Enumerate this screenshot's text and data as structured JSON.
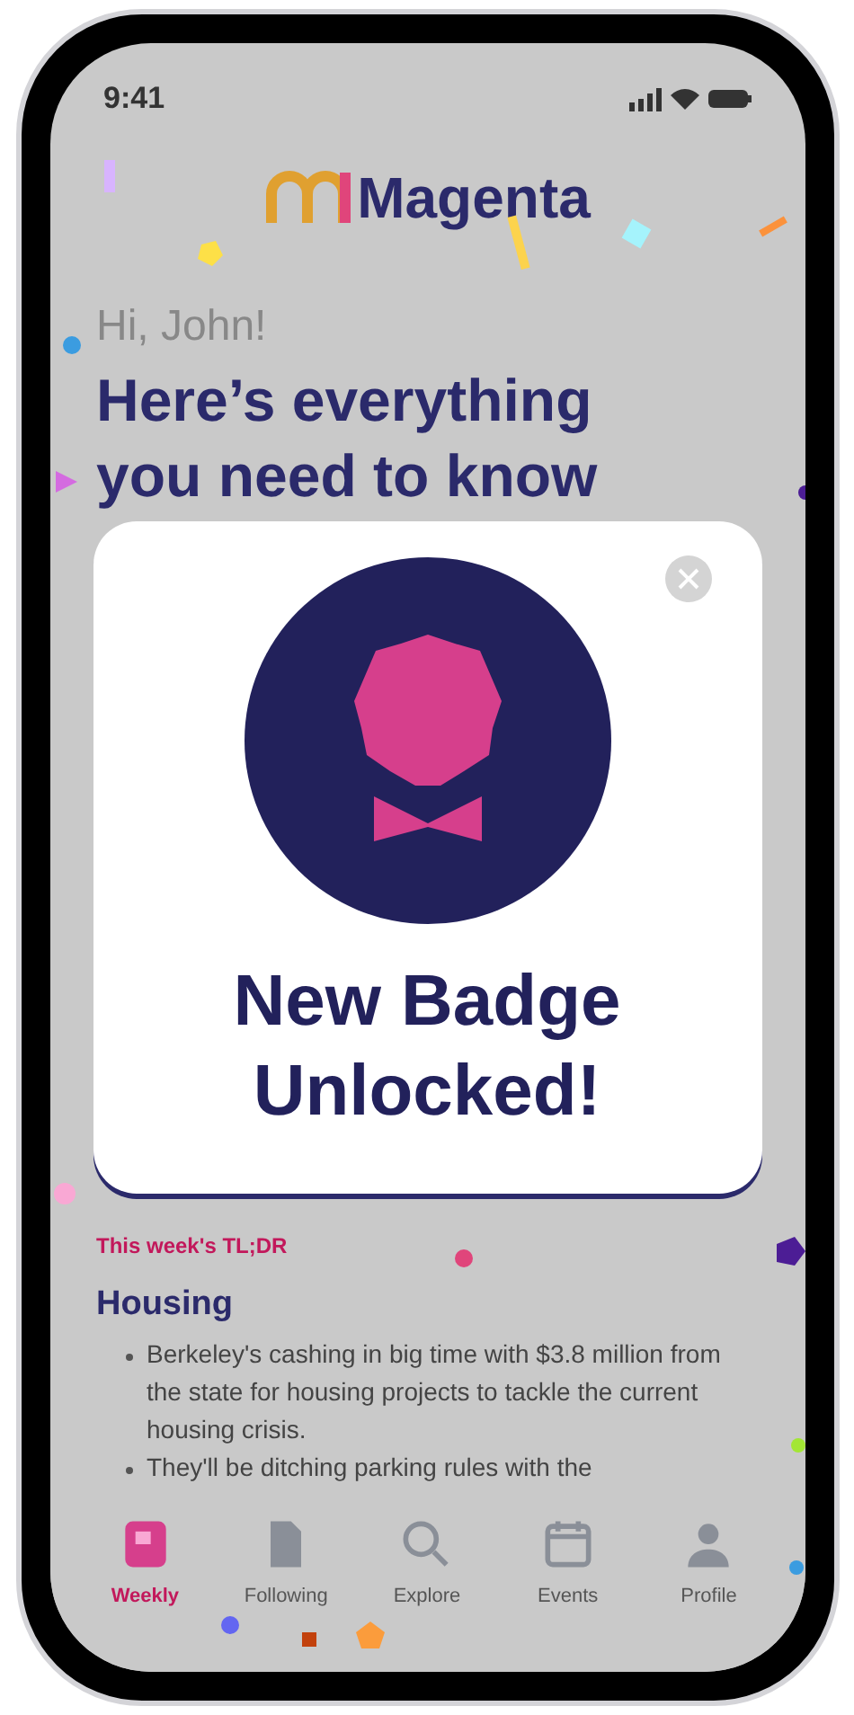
{
  "status_bar": {
    "time": "9:41"
  },
  "header": {
    "logo_text": "Magenta"
  },
  "greeting": "Hi, John!",
  "headline": "Here’s everything you need to know",
  "tldr": {
    "label": "This week's TL;DR",
    "title": "Housing",
    "bullets": [
      "Berkeley's cashing in big time with $3.8 million from the state for housing projects to tackle the current housing crisis.",
      "They'll be ditching parking rules with the"
    ]
  },
  "modal": {
    "title": "New Badge Unlocked!"
  },
  "tab_bar": [
    {
      "label": "Weekly",
      "selected": true
    },
    {
      "label": "Following",
      "selected": false
    },
    {
      "label": "Explore",
      "selected": false
    },
    {
      "label": "Events",
      "selected": false
    },
    {
      "label": "Profile",
      "selected": false
    }
  ]
}
